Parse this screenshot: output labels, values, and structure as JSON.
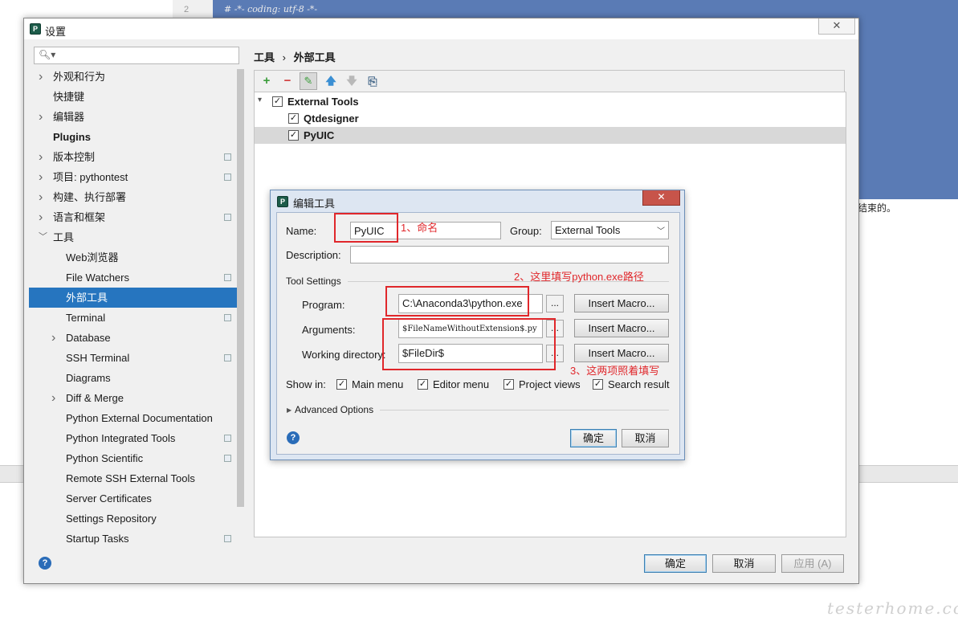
{
  "background": {
    "line_number": "2",
    "code_line": "# -*- coding: utf-8 -*-",
    "snippet": "结束的。",
    "watermark": "testerhome.com"
  },
  "settings": {
    "title": "设置",
    "search_placeholder": "",
    "tree": [
      {
        "label": "外观和行为",
        "arrow": "right",
        "indent": 0,
        "bold": false
      },
      {
        "label": "快捷键",
        "arrow": "",
        "indent": 0,
        "bold": false
      },
      {
        "label": "编辑器",
        "arrow": "right",
        "indent": 0,
        "bold": false
      },
      {
        "label": "Plugins",
        "arrow": "",
        "indent": 0,
        "bold": true
      },
      {
        "label": "版本控制",
        "arrow": "right",
        "indent": 0,
        "bold": false
      },
      {
        "label": "项目: pythontest",
        "arrow": "right",
        "indent": 0,
        "bold": false
      },
      {
        "label": "构建、执行部署",
        "arrow": "right",
        "indent": 0,
        "bold": false
      },
      {
        "label": "语言和框架",
        "arrow": "right",
        "indent": 0,
        "bold": false
      },
      {
        "label": "工具",
        "arrow": "down",
        "indent": 0,
        "bold": false
      },
      {
        "label": "Web浏览器",
        "arrow": "",
        "indent": 1,
        "bold": false
      },
      {
        "label": "File Watchers",
        "arrow": "",
        "indent": 1,
        "bold": false
      },
      {
        "label": "外部工具",
        "arrow": "",
        "indent": 1,
        "bold": false
      },
      {
        "label": "Terminal",
        "arrow": "",
        "indent": 1,
        "bold": false
      },
      {
        "label": "Database",
        "arrow": "right",
        "indent": 1,
        "bold": false
      },
      {
        "label": "SSH Terminal",
        "arrow": "",
        "indent": 1,
        "bold": false
      },
      {
        "label": "Diagrams",
        "arrow": "",
        "indent": 1,
        "bold": false
      },
      {
        "label": "Diff & Merge",
        "arrow": "right",
        "indent": 1,
        "bold": false
      },
      {
        "label": "Python External Documentation",
        "arrow": "",
        "indent": 1,
        "bold": false
      },
      {
        "label": "Python Integrated Tools",
        "arrow": "",
        "indent": 1,
        "bold": false
      },
      {
        "label": "Python Scientific",
        "arrow": "",
        "indent": 1,
        "bold": false
      },
      {
        "label": "Remote SSH External Tools",
        "arrow": "",
        "indent": 1,
        "bold": false
      },
      {
        "label": "Server Certificates",
        "arrow": "",
        "indent": 1,
        "bold": false
      },
      {
        "label": "Settings Repository",
        "arrow": "",
        "indent": 1,
        "bold": false
      },
      {
        "label": "Startup Tasks",
        "arrow": "",
        "indent": 1,
        "bold": false
      }
    ],
    "selected_item": "外部工具",
    "breadcrumb": {
      "parent": "工具",
      "separator": "›",
      "current": "外部工具"
    },
    "toolbar": {
      "add": "+",
      "remove": "−",
      "edit": "✎",
      "up": "🡅",
      "down": "🡇",
      "copy": "⎘"
    },
    "tools_tree": {
      "group": "External Tools",
      "items": [
        "Qtdesigner",
        "PyUIC"
      ],
      "selected": "PyUIC"
    },
    "buttons": {
      "ok": "确定",
      "cancel": "取消",
      "apply": "应用 (A)"
    }
  },
  "edit_dialog": {
    "title": "编辑工具",
    "name_label": "Name:",
    "name_value": "PyUIC",
    "group_label": "Group:",
    "group_value": "External Tools",
    "description_label": "Description:",
    "description_value": "",
    "tool_settings_label": "Tool Settings",
    "program_label": "Program:",
    "program_value": "C:\\Anaconda3\\python.exe",
    "arguments_label": "Arguments:",
    "arguments_value": "$FileNameWithoutExtension$.py",
    "workdir_label": "Working directory:",
    "workdir_value": "$FileDir$",
    "browse_label": "...",
    "insert_macro": "Insert Macro...",
    "show_in_label": "Show in:",
    "show_in": [
      "Main menu",
      "Editor menu",
      "Project views",
      "Search result"
    ],
    "advanced_options": "Advanced Options",
    "ok": "确定",
    "cancel": "取消"
  },
  "annotations": {
    "name_note": "1、命名",
    "program_note": "2、这里填写python.exe路径",
    "args_note": "3、这两项照着填写",
    "color": "#e0272b"
  }
}
